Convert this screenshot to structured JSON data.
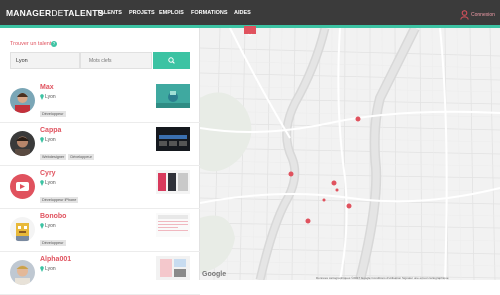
{
  "brand": {
    "strong": "MANAGER",
    "light": "DE",
    "rest": "TALENTS"
  },
  "nav": [
    "TALENTS",
    "PROJETS",
    "EMPLOIS",
    "FORMATIONS",
    "AIDES"
  ],
  "login_label": "Connexion",
  "search": {
    "title": "Trouver un talent",
    "help_glyph": "?",
    "city_value": "Lyon",
    "keywords_placeholder": "Mots clefs"
  },
  "talents": [
    {
      "name": "Max",
      "location": "Lyon",
      "tags": [
        "Développeur"
      ]
    },
    {
      "name": "Cappa",
      "location": "Lyon",
      "tags": [
        "Webdesigner",
        "Développeur"
      ]
    },
    {
      "name": "Cyry",
      "location": "Lyon",
      "tags": [
        "Développeur iPhone"
      ]
    },
    {
      "name": "Bonobo",
      "location": "Lyon",
      "tags": [
        "Développeur"
      ]
    },
    {
      "name": "Alpha001",
      "location": "Lyon",
      "tags": []
    }
  ],
  "map": {
    "google_label": "Google",
    "attribution": "Données cartographiques ©2017 Google   Conditions d'utilisation   Signaler une erreur cartographique",
    "accent": "#3cc3a3",
    "marker_color": "#e0525e"
  }
}
